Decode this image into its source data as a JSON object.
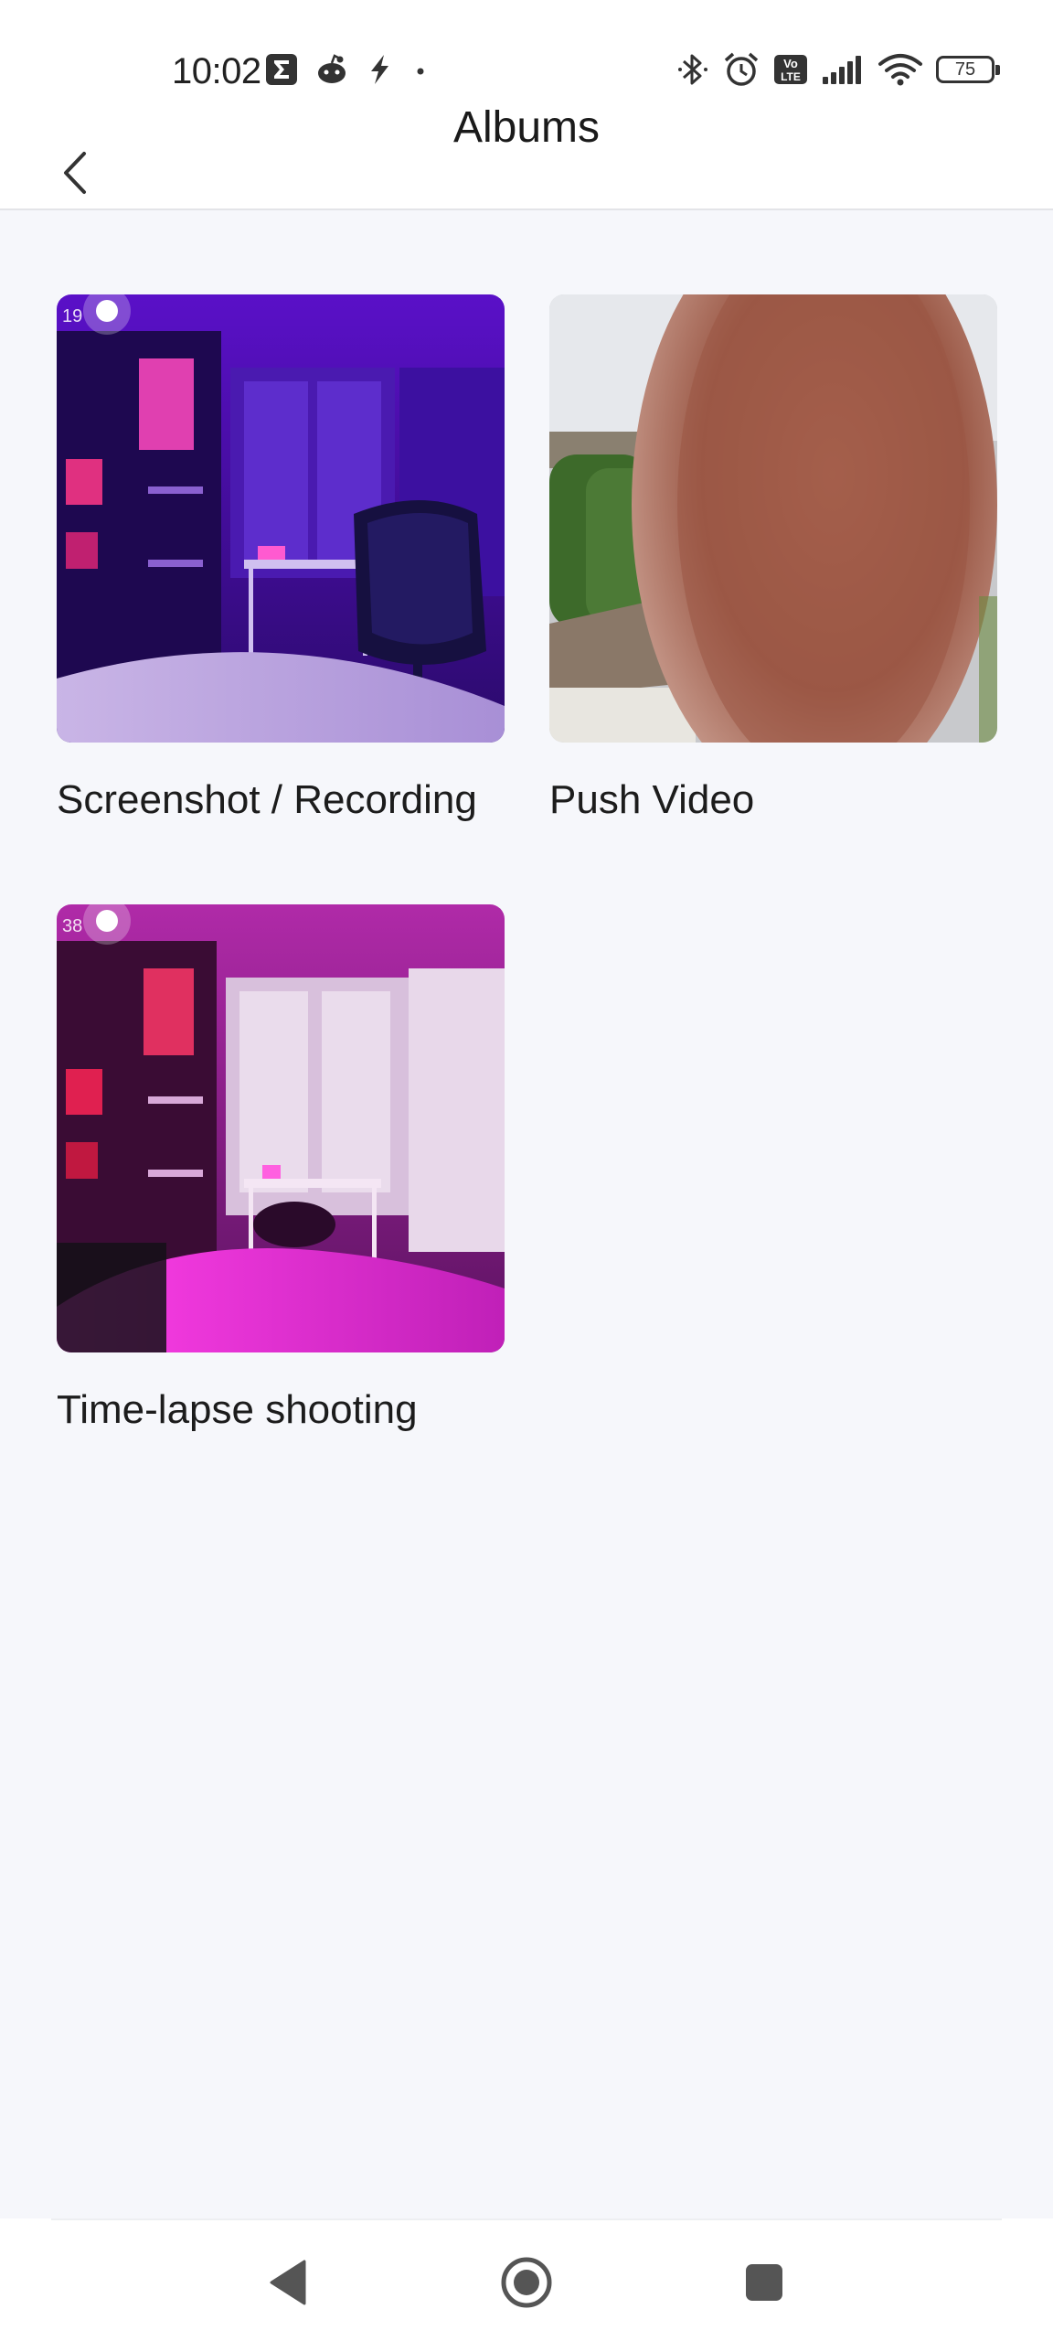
{
  "status_bar": {
    "time": "10:02",
    "left_icons": [
      "sigma-app-icon",
      "reddit-icon",
      "flash-icon",
      "dot-icon"
    ],
    "right_icons": [
      "bluetooth-icon",
      "alarm-icon",
      "volte-icon",
      "signal-icon",
      "wifi-icon"
    ],
    "volte_text_top": "Vo",
    "volte_text_bottom": "LTE",
    "battery": "75"
  },
  "header": {
    "title": "Albums",
    "back_icon": "chevron-left-icon"
  },
  "albums": [
    {
      "label": "Screenshot / Recording",
      "thumb_overlay": "19"
    },
    {
      "label": "Push Video",
      "thumb_overlay": ""
    },
    {
      "label": "Time-lapse shooting",
      "thumb_overlay": "38"
    }
  ],
  "nav_bar": {
    "icons": [
      "back-triangle-icon",
      "home-circle-icon",
      "recents-square-icon"
    ]
  },
  "colors": {
    "background": "#f6f7fb",
    "header": "#ffffff",
    "text": "#1a1a1a"
  }
}
